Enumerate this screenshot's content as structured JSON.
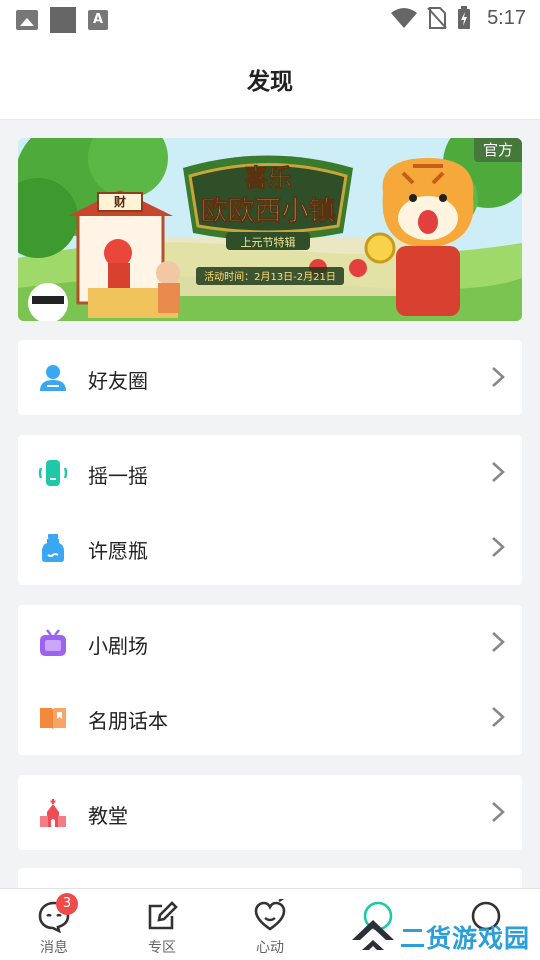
{
  "status_bar": {
    "time": "5:17"
  },
  "header": {
    "title": "发现"
  },
  "banner": {
    "badge": "官方",
    "title_line1": "喜乐",
    "title_line2": "欧欧西小镇",
    "subtitle": "上元节特辑",
    "activity_time": "活动时间：2月13日-2月21日",
    "stamp": "财",
    "slide_count": 7,
    "active_slide": 0
  },
  "groups": [
    [
      {
        "label": "好友圈",
        "icon": "friends-icon"
      }
    ],
    [
      {
        "label": "摇一摇",
        "icon": "shake-icon"
      },
      {
        "label": "许愿瓶",
        "icon": "bottle-icon"
      }
    ],
    [
      {
        "label": "小剧场",
        "icon": "tv-icon"
      },
      {
        "label": "名朋话本",
        "icon": "book-icon"
      }
    ],
    [
      {
        "label": "教堂",
        "icon": "church-icon"
      }
    ]
  ],
  "tabbar": {
    "items": [
      {
        "label": "消息",
        "badge": "3"
      },
      {
        "label": "专区"
      },
      {
        "label": "心动"
      },
      {
        "label": ""
      },
      {
        "label": ""
      }
    ]
  },
  "watermark": {
    "text": "二货游戏园"
  },
  "colors": {
    "accent": "#1ec9a8",
    "blue": "#3ba7f2",
    "purple": "#9b64f0",
    "orange": "#f28a3c",
    "red": "#ee4b55",
    "badge": "#ef4b4b"
  }
}
